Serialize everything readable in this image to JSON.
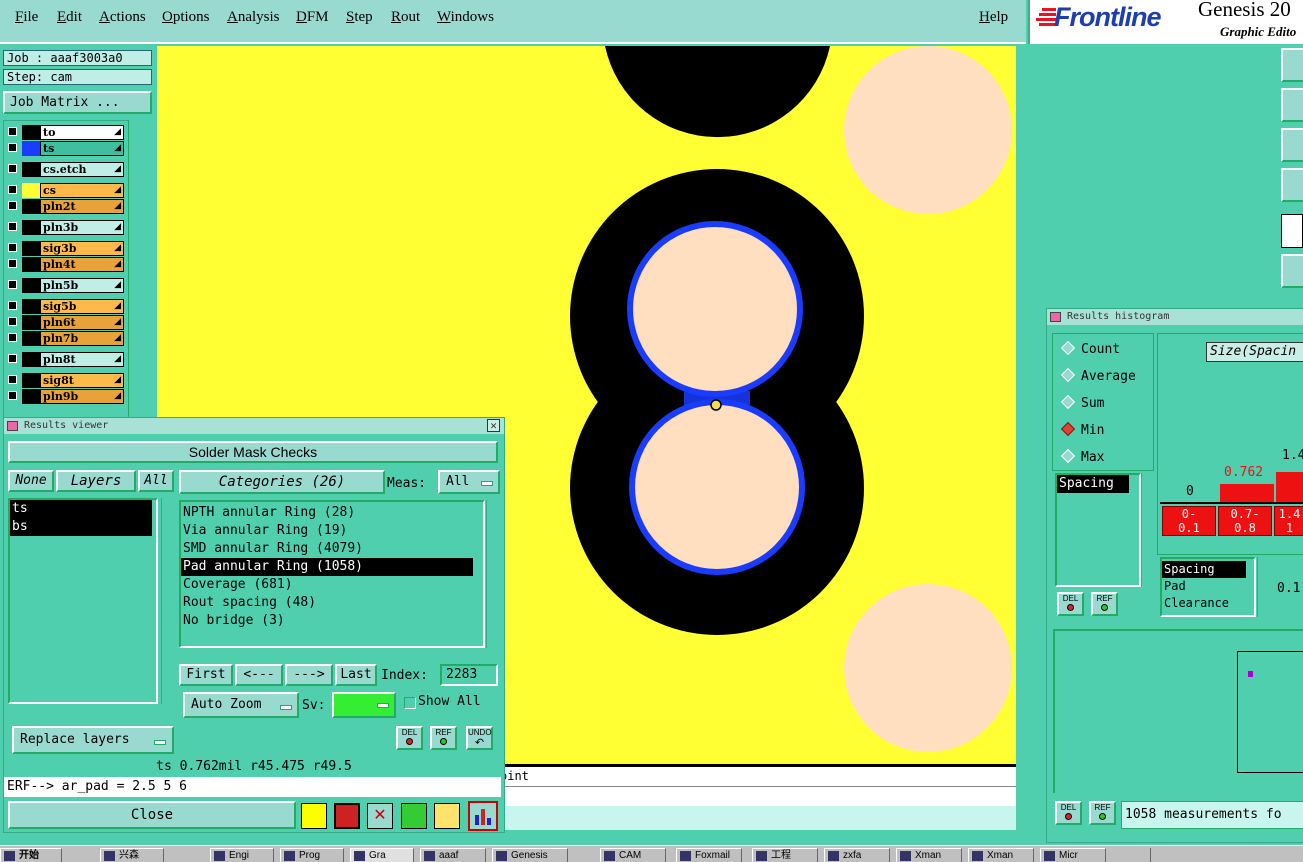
{
  "menu": [
    "File",
    "Edit",
    "Actions",
    "Options",
    "Analysis",
    "DFM",
    "Step",
    "Rout",
    "Windows"
  ],
  "help": "Help",
  "logo": {
    "brand": "Frontline",
    "product": "Genesis 20",
    "subtitle": "Graphic Edito"
  },
  "job": {
    "job_label": "Job : aaaf3003a0",
    "step_label": "Step: cam",
    "matrix_btn": "Job Matrix ..."
  },
  "layers": [
    {
      "name": "to",
      "swatch": "#000000",
      "bg": "#ffffff"
    },
    {
      "name": "ts",
      "swatch": "#1a3cff",
      "bg": "#3fbfa0"
    },
    {
      "name": "cs.etch",
      "swatch": "#000000",
      "bg": "#bfeee6"
    },
    {
      "name": "cs",
      "swatch": "#ffff33",
      "bg": "#ffb84a"
    },
    {
      "name": "pln2t",
      "swatch": "#000000",
      "bg": "#e9a13a"
    },
    {
      "name": "pln3b",
      "swatch": "#000000",
      "bg": "#bfeee6"
    },
    {
      "name": "sig3b",
      "swatch": "#000000",
      "bg": "#ffb84a"
    },
    {
      "name": "pln4t",
      "swatch": "#000000",
      "bg": "#e9a13a"
    },
    {
      "name": "pln5b",
      "swatch": "#000000",
      "bg": "#bfeee6"
    },
    {
      "name": "sig5b",
      "swatch": "#000000",
      "bg": "#ffb84a"
    },
    {
      "name": "pln6t",
      "swatch": "#000000",
      "bg": "#e9a13a"
    },
    {
      "name": "pln7b",
      "swatch": "#000000",
      "bg": "#e9a13a"
    },
    {
      "name": "pln8t",
      "swatch": "#000000",
      "bg": "#bfeee6"
    },
    {
      "name": "sig8t",
      "swatch": "#000000",
      "bg": "#ffb84a"
    },
    {
      "name": "pln9b",
      "swatch": "#000000",
      "bg": "#e9a13a"
    }
  ],
  "results_viewer": {
    "title": "Results viewer",
    "heading": "Solder Mask Checks",
    "none_btn": "None",
    "layers_btn": "Layers",
    "all_btn": "All",
    "layer_items": [
      "ts",
      "bs"
    ],
    "categories_btn": "Categories (26)",
    "meas_label": "Meas:",
    "meas_value": "All",
    "categories": [
      "NPTH annular Ring (28)",
      "Via annular Ring (19)",
      "SMD annular Ring (4079)",
      "Pad annular Ring (1058)",
      "Coverage (681)",
      "Rout spacing (48)",
      "No bridge (3)"
    ],
    "first": "First",
    "prev": "<---",
    "next": "--->",
    "last": "Last",
    "index_label": "Index:",
    "index_value": "2283",
    "auto_zoom": "Auto Zoom",
    "sv_label": "Sv:",
    "show_all": "Show All",
    "replace_layers": "Replace layers",
    "del": "DEL",
    "ref": "REF",
    "undo": "UNDO",
    "status": "ts 0.762mil  r45.475  r49.5",
    "erf": "ERF--> ar_pad = 2.5 5 6",
    "close": "Close"
  },
  "canvas_status": "oint",
  "histogram": {
    "title": "Results histogram",
    "modes": [
      "Count",
      "Average",
      "Sum",
      "Min",
      "Max"
    ],
    "selected_mode": "Min",
    "size_label": "Size(Spacin",
    "list_item": "Spacing",
    "bins": [
      {
        "label": "0-\n0.1",
        "value": "0"
      },
      {
        "label": "0.7-\n0.8",
        "value": "0.762"
      },
      {
        "label": "1.4\n1",
        "value": "1.4"
      }
    ],
    "attr_list": [
      "Spacing",
      "Pad",
      "Clearance"
    ],
    "side_value": "0.1",
    "del": "DEL",
    "ref": "REF",
    "footer": "1058 measurements fo"
  },
  "taskbar": {
    "start": "开始",
    "items": [
      "兴森",
      "Engi",
      "Prog",
      "Gra",
      "aaaf",
      "Genesis",
      "CAM",
      "Foxmail",
      "工程",
      "zxfa",
      "Xman",
      "Xman",
      "Micr"
    ]
  }
}
